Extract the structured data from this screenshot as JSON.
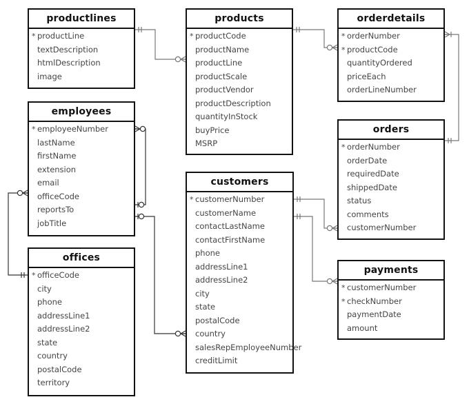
{
  "diagram": {
    "type": "entity-relationship",
    "entities": [
      {
        "id": "productlines",
        "name": "productlines",
        "attributes": [
          {
            "name": "productLine",
            "pk": true
          },
          {
            "name": "textDescription",
            "pk": false
          },
          {
            "name": "htmlDescription",
            "pk": false
          },
          {
            "name": "image",
            "pk": false
          }
        ]
      },
      {
        "id": "products",
        "name": "products",
        "attributes": [
          {
            "name": "productCode",
            "pk": true
          },
          {
            "name": "productName",
            "pk": false
          },
          {
            "name": "productLine",
            "pk": false
          },
          {
            "name": "productScale",
            "pk": false
          },
          {
            "name": "productVendor",
            "pk": false
          },
          {
            "name": "productDescription",
            "pk": false
          },
          {
            "name": "quantityInStock",
            "pk": false
          },
          {
            "name": "buyPrice",
            "pk": false
          },
          {
            "name": "MSRP",
            "pk": false
          }
        ]
      },
      {
        "id": "orderdetails",
        "name": "orderdetails",
        "attributes": [
          {
            "name": "orderNumber",
            "pk": true
          },
          {
            "name": "productCode",
            "pk": true
          },
          {
            "name": "quantityOrdered",
            "pk": false
          },
          {
            "name": "priceEach",
            "pk": false
          },
          {
            "name": "orderLineNumber",
            "pk": false
          }
        ]
      },
      {
        "id": "employees",
        "name": "employees",
        "attributes": [
          {
            "name": "employeeNumber",
            "pk": true
          },
          {
            "name": "lastName",
            "pk": false
          },
          {
            "name": "firstName",
            "pk": false
          },
          {
            "name": "extension",
            "pk": false
          },
          {
            "name": "email",
            "pk": false
          },
          {
            "name": "officeCode",
            "pk": false
          },
          {
            "name": "reportsTo",
            "pk": false
          },
          {
            "name": "jobTitle",
            "pk": false
          }
        ]
      },
      {
        "id": "orders",
        "name": "orders",
        "attributes": [
          {
            "name": "orderNumber",
            "pk": true
          },
          {
            "name": "orderDate",
            "pk": false
          },
          {
            "name": "requiredDate",
            "pk": false
          },
          {
            "name": "shippedDate",
            "pk": false
          },
          {
            "name": "status",
            "pk": false
          },
          {
            "name": "comments",
            "pk": false
          },
          {
            "name": "customerNumber",
            "pk": false
          }
        ]
      },
      {
        "id": "customers",
        "name": "customers",
        "attributes": [
          {
            "name": "customerNumber",
            "pk": true
          },
          {
            "name": "customerName",
            "pk": false
          },
          {
            "name": "contactLastName",
            "pk": false
          },
          {
            "name": "contactFirstName",
            "pk": false
          },
          {
            "name": "phone",
            "pk": false
          },
          {
            "name": "addressLine1",
            "pk": false
          },
          {
            "name": "addressLine2",
            "pk": false
          },
          {
            "name": "city",
            "pk": false
          },
          {
            "name": "state",
            "pk": false
          },
          {
            "name": "postalCode",
            "pk": false
          },
          {
            "name": "country",
            "pk": false
          },
          {
            "name": "salesRepEmployeeNumber",
            "pk": false
          },
          {
            "name": "creditLimit",
            "pk": false
          }
        ]
      },
      {
        "id": "offices",
        "name": "offices",
        "attributes": [
          {
            "name": "officeCode",
            "pk": true
          },
          {
            "name": "city",
            "pk": false
          },
          {
            "name": "phone",
            "pk": false
          },
          {
            "name": "addressLine1",
            "pk": false
          },
          {
            "name": "addressLine2",
            "pk": false
          },
          {
            "name": "state",
            "pk": false
          },
          {
            "name": "country",
            "pk": false
          },
          {
            "name": "postalCode",
            "pk": false
          },
          {
            "name": "territory",
            "pk": false
          }
        ]
      },
      {
        "id": "payments",
        "name": "payments",
        "attributes": [
          {
            "name": "customerNumber",
            "pk": true
          },
          {
            "name": "checkNumber",
            "pk": true
          },
          {
            "name": "paymentDate",
            "pk": false
          },
          {
            "name": "amount",
            "pk": false
          }
        ]
      }
    ],
    "pk_marker": "*",
    "relationships": [
      {
        "from": "productlines.productLine",
        "from_card": "exactly-one",
        "to": "products.productLine",
        "to_card": "zero-or-many"
      },
      {
        "from": "products.productCode",
        "from_card": "exactly-one",
        "to": "orderdetails.productCode",
        "to_card": "zero-or-many"
      },
      {
        "from": "orders.orderNumber",
        "from_card": "exactly-one",
        "to": "orderdetails.orderNumber",
        "to_card": "one-or-many"
      },
      {
        "from": "customers.customerNumber",
        "from_card": "exactly-one",
        "to": "orders.customerNumber",
        "to_card": "zero-or-many"
      },
      {
        "from": "customers.customerNumber",
        "from_card": "exactly-one",
        "to": "payments.customerNumber",
        "to_card": "zero-or-many"
      },
      {
        "from": "employees.reportsTo",
        "from_card": "zero-or-one",
        "to": "employees.employeeNumber",
        "to_card": "zero-or-many"
      },
      {
        "from": "employees.jobTitle",
        "from_card": "zero-or-one",
        "to": "customers.country",
        "to_card": "zero-or-many"
      },
      {
        "from": "offices.officeCode",
        "from_card": "exactly-one",
        "to": "employees.officeCode",
        "to_card": "zero-or-many"
      }
    ],
    "colors": {
      "entity_border": "#111111",
      "entity_title": "#111111",
      "attribute_text": "#444444",
      "connector_gray": "#777777",
      "connector_dark": "#333333"
    }
  }
}
